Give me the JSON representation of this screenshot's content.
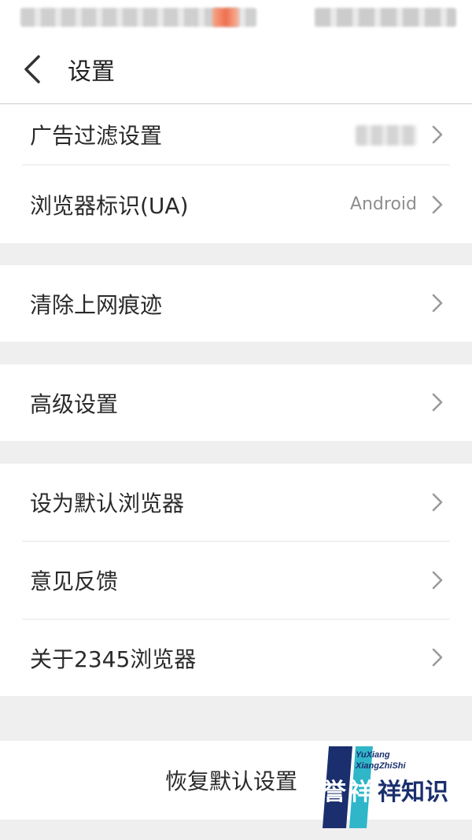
{
  "header": {
    "title": "设置"
  },
  "group1": {
    "items": [
      {
        "label": "广告过滤设置",
        "value": ""
      },
      {
        "label": "浏览器标识(UA)",
        "value": "Android"
      }
    ]
  },
  "group2": {
    "items": [
      {
        "label": "清除上网痕迹"
      }
    ]
  },
  "group3": {
    "items": [
      {
        "label": "高级设置"
      }
    ]
  },
  "group4": {
    "items": [
      {
        "label": "设为默认浏览器"
      },
      {
        "label": "意见反馈"
      },
      {
        "label": "关于2345浏览器"
      }
    ]
  },
  "reset": {
    "label": "恢复默认设置"
  },
  "watermark": {
    "line1": "YuXiang",
    "line2": "XiangZhiShi",
    "text_a": "誉",
    "text_b": "祥",
    "text_c": "祥知识"
  },
  "colors": {
    "background": "#efefef",
    "row_background": "#ffffff",
    "label": "#2a2a2a",
    "secondary": "#8e8e8e",
    "chevron": "#9a9a9a",
    "watermark_navy": "#1b2f6e",
    "watermark_teal": "#2fb6c9"
  }
}
